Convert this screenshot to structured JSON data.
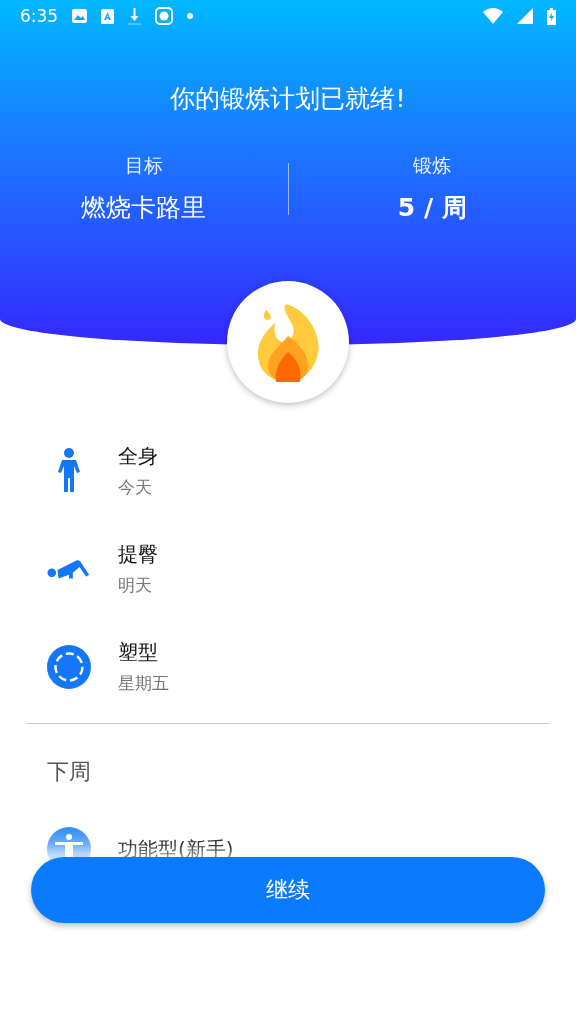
{
  "status_bar": {
    "time": "6:35"
  },
  "header": {
    "title": "你的锻炼计划已就绪!",
    "stats": [
      {
        "label": "目标",
        "value": "燃烧卡路里"
      },
      {
        "label": "锻炼",
        "value": "5 / 周"
      }
    ]
  },
  "this_week": [
    {
      "kind": "person",
      "name": "全身",
      "day": "今天"
    },
    {
      "kind": "pushup",
      "name": "提臀",
      "day": "明天"
    },
    {
      "kind": "ring",
      "name": "塑型",
      "day": "星期五"
    }
  ],
  "next_week": {
    "heading": "下周",
    "items": [
      {
        "kind": "stretch",
        "name": "功能型(新手)"
      }
    ]
  },
  "continue_button": "继续"
}
